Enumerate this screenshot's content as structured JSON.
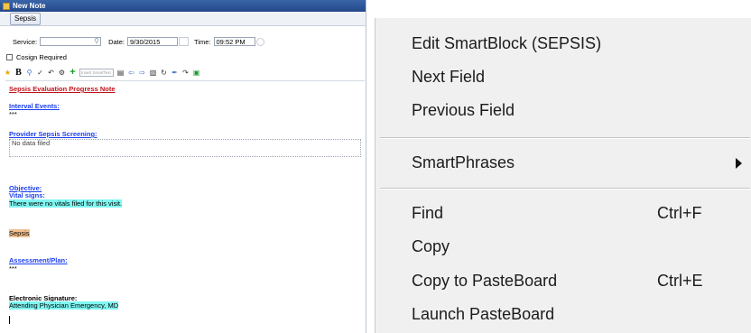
{
  "window": {
    "title": "New Note",
    "tab_label": "Sepsis"
  },
  "header": {
    "service_label": "Service:",
    "service_value": "",
    "date_label": "Date:",
    "date_value": "9/30/2015",
    "time_label": "Time:",
    "time_value": "09:52 PM",
    "cosign_label": "Cosign Required"
  },
  "toolbar": {
    "smarttext_placeholder": "Insert SmartText"
  },
  "note": {
    "title": "Sepsis Evaluation Progress Note",
    "interval_events_heading": "Interval Events:",
    "interval_events_value": "***",
    "screening_heading": "Provider Sepsis Screening:",
    "screening_value": "No data filed",
    "objective_heading": "Objective:",
    "vitals_heading": "Vital signs:",
    "vitals_value": "There were no vitals filed for this visit.",
    "sepsis_block": "Sepsis",
    "assessment_heading": "Assessment/Plan:",
    "assessment_value": "***",
    "signature_heading": "Electronic Signature:",
    "signature_value": "Attending Physician Emergency, MD"
  },
  "context_menu": {
    "items": [
      {
        "label": "Edit SmartBlock (SEPSIS)",
        "shortcut": ""
      },
      {
        "label": "Next Field",
        "shortcut": ""
      },
      {
        "label": "Previous Field",
        "shortcut": ""
      },
      {
        "label": "SmartPhrases",
        "shortcut": ""
      },
      {
        "label": "Find",
        "shortcut": "Ctrl+F"
      },
      {
        "label": "Copy",
        "shortcut": ""
      },
      {
        "label": "Copy to PasteBoard",
        "shortcut": "Ctrl+E"
      },
      {
        "label": "Launch PasteBoard",
        "shortcut": ""
      }
    ]
  },
  "colors": {
    "title_bar": "#23498a",
    "heading_red": "#c0121b",
    "heading_blue": "#1c3ff0",
    "highlight_cyan": "#7ff7f2",
    "highlight_orange": "#f2c08f",
    "menu_bg": "#f0f0f0"
  }
}
